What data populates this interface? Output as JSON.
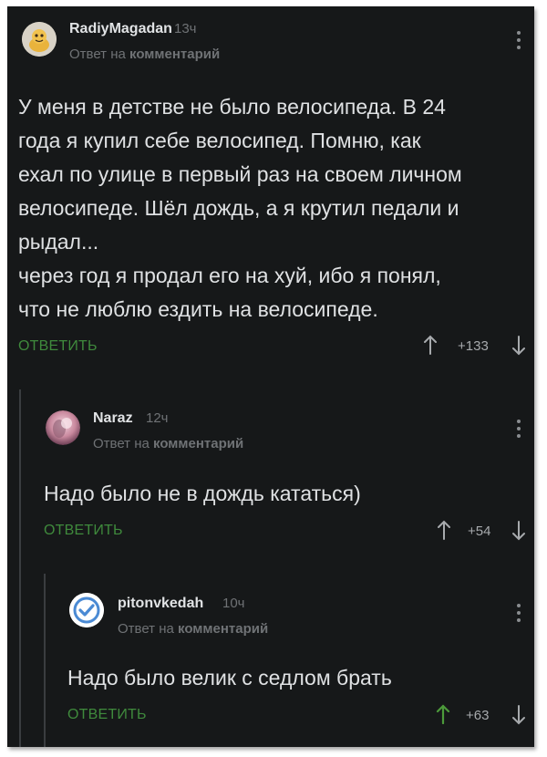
{
  "comments": [
    {
      "author": "RadiyMagadan",
      "time": "13ч",
      "reply_prefix": "Ответ на",
      "reply_target": "комментарий",
      "lines": [
        "У меня в детстве не было велосипеда. В 24",
        "года я купил себе велосипед. Помню, как",
        "ехал по улице в первый раз на своем личном",
        "велосипеде. Шёл дождь, а я крутил педали и",
        "рыдал...",
        "через год я продал его на хуй, ибо я понял,",
        "что не люблю ездить на велосипеде."
      ],
      "reply_label": "ОТВЕТИТЬ",
      "score": "+133"
    },
    {
      "author": "Naraz",
      "time": "12ч",
      "reply_prefix": "Ответ на",
      "reply_target": "комментарий",
      "lines": [
        "Надо было не в дождь кататься)"
      ],
      "reply_label": "ОТВЕТИТЬ",
      "score": "+54"
    },
    {
      "author": "pitonvkedah",
      "time": "10ч",
      "reply_prefix": "Ответ на",
      "reply_target": "комментарий",
      "lines": [
        "Надо было велик с седлом брать"
      ],
      "reply_label": "ОТВЕТИТЬ",
      "score": "+63"
    }
  ],
  "colors": {
    "background": "#161819",
    "reply_link": "#3f8a3c",
    "upvoted_arrow": "#4c9a3a",
    "text": "#dfe1e3",
    "muted": "#6f7275"
  }
}
